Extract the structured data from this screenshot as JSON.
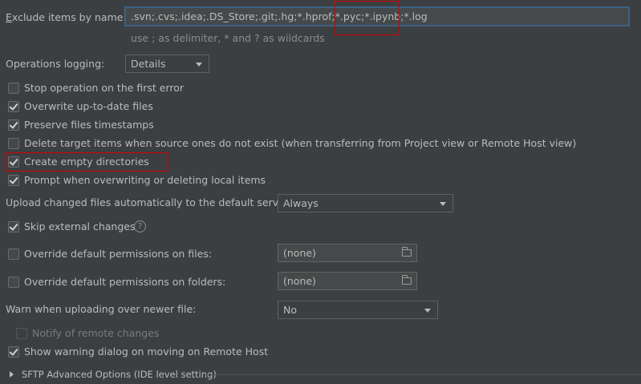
{
  "exclude": {
    "label_prefix": "E",
    "label_rest": "xclude items by name:",
    "value": ".svn;.cvs;.idea;.DS_Store;.git;.hg;*.hprof;*.pyc;*.ipynb;*.log",
    "hint": "use ; as delimiter, * and ? as wildcards"
  },
  "logging": {
    "label": "Operations logging:",
    "value": "Details"
  },
  "checkboxes": {
    "stop_on_error": {
      "label": "Stop operation on the first error",
      "checked": false
    },
    "overwrite_uptodate": {
      "label": "Overwrite up-to-date files",
      "checked": true
    },
    "preserve_timestamps": {
      "label": "Preserve files timestamps",
      "checked": true
    },
    "delete_target": {
      "label": "Delete target items when source ones do not exist (when transferring from Project view or Remote Host view)",
      "checked": false
    },
    "create_empty_dirs": {
      "label": "Create empty directories",
      "checked": true
    },
    "prompt_overwrite": {
      "label": "Prompt when overwriting or deleting local items",
      "checked": true
    },
    "skip_external": {
      "label": "Skip external changes",
      "checked": true
    },
    "override_files": {
      "label": "Override default permissions on files:",
      "checked": false
    },
    "override_folders": {
      "label": "Override default permissions on folders:",
      "checked": false
    },
    "notify_remote": {
      "label": "Notify of remote changes",
      "checked": false
    },
    "show_warning_dialog": {
      "label": "Show warning dialog on moving on Remote Host",
      "checked": true
    }
  },
  "upload": {
    "label": "Upload changed files automatically to the default server",
    "value": "Always"
  },
  "permissions": {
    "files_value": "(none)",
    "folders_value": "(none)"
  },
  "warn": {
    "label": "Warn when uploading over newer file:",
    "value": "No"
  },
  "sftp": {
    "label": "SFTP Advanced Options (IDE level setting)"
  },
  "colors": {
    "background": "#3c3f41",
    "text": "#bbbbbb",
    "focus_border": "#3d6185",
    "highlight_box": "#d40000"
  }
}
